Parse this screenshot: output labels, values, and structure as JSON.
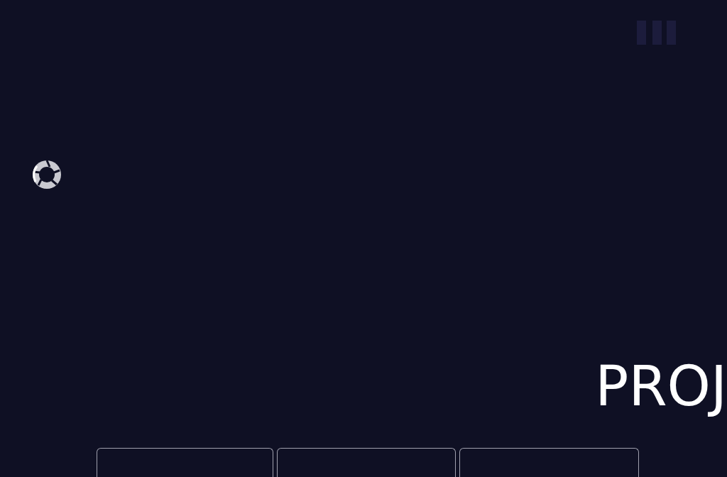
{
  "heading": "PROJ"
}
